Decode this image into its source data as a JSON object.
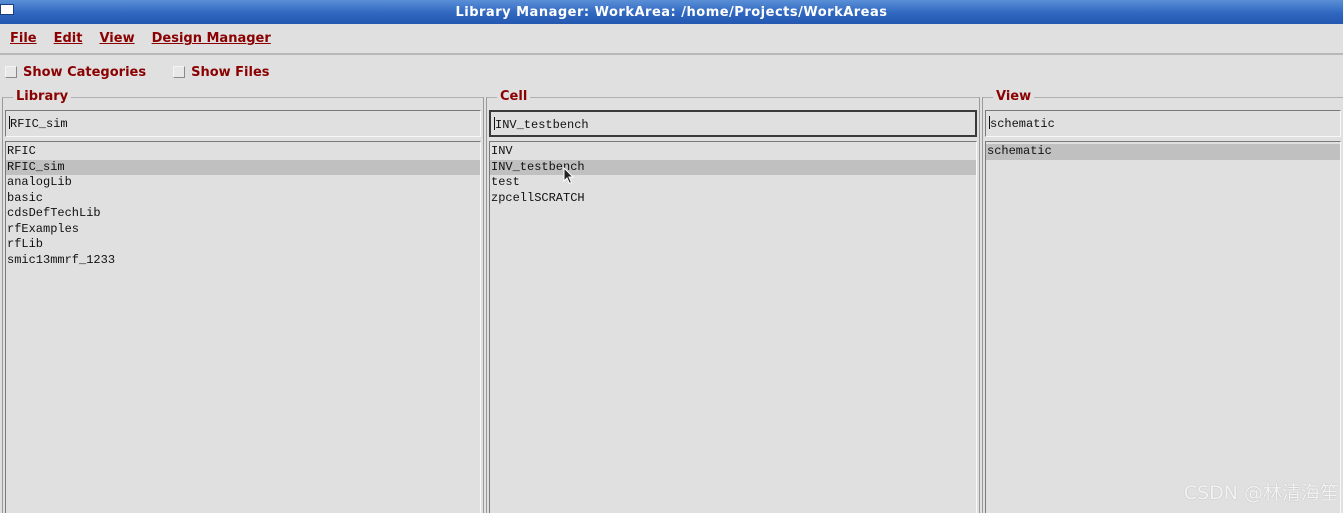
{
  "window": {
    "title": "Library Manager: WorkArea: /home/Projects/WorkAreas"
  },
  "menu": {
    "items": [
      {
        "label": "File"
      },
      {
        "label": "Edit"
      },
      {
        "label": "View"
      },
      {
        "label": "Design Manager"
      }
    ]
  },
  "options": {
    "show_categories": {
      "label": "Show Categories",
      "checked": false
    },
    "show_files": {
      "label": "Show Files",
      "checked": false
    }
  },
  "library": {
    "title": "Library",
    "field_value": "RFIC_sim",
    "items": [
      "RFIC",
      "RFIC_sim",
      "analogLib",
      "basic",
      "cdsDefTechLib",
      "rfExamples",
      "rfLib",
      "smic13mmrf_1233"
    ],
    "selected": "RFIC_sim"
  },
  "cell": {
    "title": "Cell",
    "field_value": "INV_testbench",
    "items": [
      "INV",
      "INV_testbench",
      "test",
      "zpcellSCRATCH"
    ],
    "selected": "INV_testbench"
  },
  "view": {
    "title": "View",
    "field_value": "schematic",
    "items": [
      "schematic"
    ],
    "selected": "schematic"
  },
  "watermark": "CSDN @林清海笙",
  "colors": {
    "titlebar": "#2f67c0",
    "label_red": "#8b0000",
    "background": "#e0e0e0",
    "selection": "#c0c0c0"
  }
}
